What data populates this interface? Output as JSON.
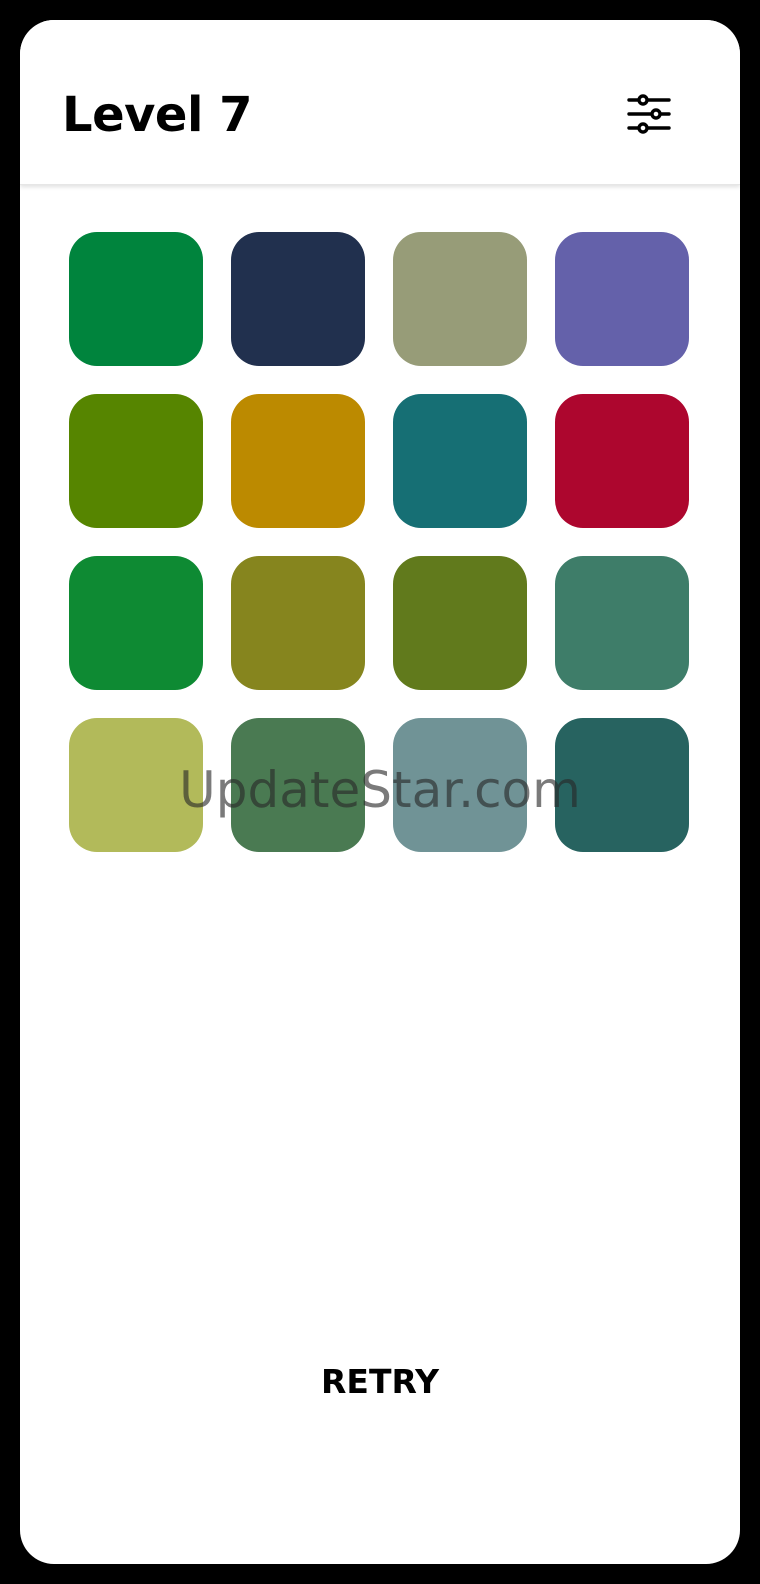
{
  "header": {
    "title": "Level 7",
    "settings_icon": "sliders-icon"
  },
  "tiles": [
    {
      "color": "#00843D"
    },
    {
      "color": "#21304E"
    },
    {
      "color": "#979C78"
    },
    {
      "color": "#6461AA"
    },
    {
      "color": "#568500"
    },
    {
      "color": "#BC8A00"
    },
    {
      "color": "#166F74"
    },
    {
      "color": "#AD062E"
    },
    {
      "color": "#0E8A33"
    },
    {
      "color": "#86851E"
    },
    {
      "color": "#617A1C"
    },
    {
      "color": "#3E7D69"
    },
    {
      "color": "#B2BA5A"
    },
    {
      "color": "#4A7A52"
    },
    {
      "color": "#709396"
    },
    {
      "color": "#276360"
    }
  ],
  "watermark": "UpdateStar.com",
  "footer": {
    "retry_label": "RETRY"
  }
}
